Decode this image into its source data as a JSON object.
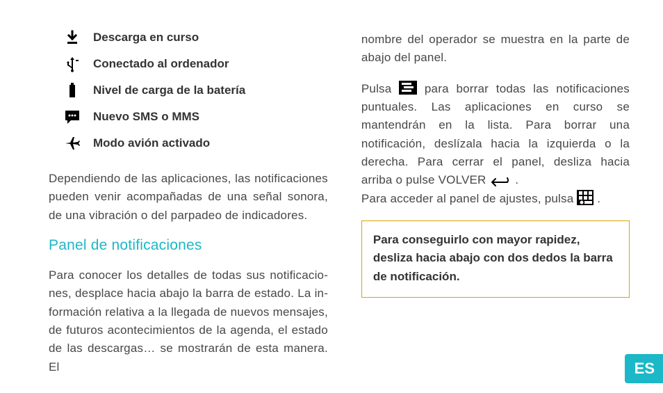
{
  "iconList": [
    {
      "icon": "download-icon",
      "label": "Descarga en curso"
    },
    {
      "icon": "usb-icon",
      "label": "Conectado al ordenador"
    },
    {
      "icon": "battery-icon",
      "label": "Nivel de carga de la batería"
    },
    {
      "icon": "sms-icon",
      "label": "Nuevo SMS o MMS"
    },
    {
      "icon": "airplane-icon",
      "label": "Modo avión activado"
    }
  ],
  "leftParagraph1": "Dependiendo de las aplicaciones, las notificaciones pueden venir acompañadas de una señal sonora, de una vibración o del parpadeo de indicadores.",
  "sectionHeading": "Panel de notificaciones",
  "leftParagraph2": "Para conocer los detalles de todas sus notificacio­nes, desplace hacia abajo la barra de estado. La in­formación relativa a la llegada de nuevos mensajes, de futuros acontecimientos de la agenda, el estado de las descargas… se mostrarán de esta manera. El",
  "rightParagraph1": "nombre del operador se muestra en la parte de abajo del panel.",
  "rightP2a": "Pulsa ",
  "rightP2b": " para borrar todas las notificaciones pun­tuales. Las aplicaciones en curso se mantendrán en la lista. Para borrar una notificación, deslízala hacia la izquierda o la derecha. Para cerrar el panel, desliza hacia arriba o pulse VOLVER ",
  "rightP2c": " .",
  "rightP3a": "Para acceder al panel de ajustes, pulsa ",
  "rightP3b": " .",
  "tipLine1": "Para conseguirlo con mayor rapidez,",
  "tipLine2": "desliza  hacia abajo con dos dedos la barra de notificación.",
  "langTab": "ES"
}
